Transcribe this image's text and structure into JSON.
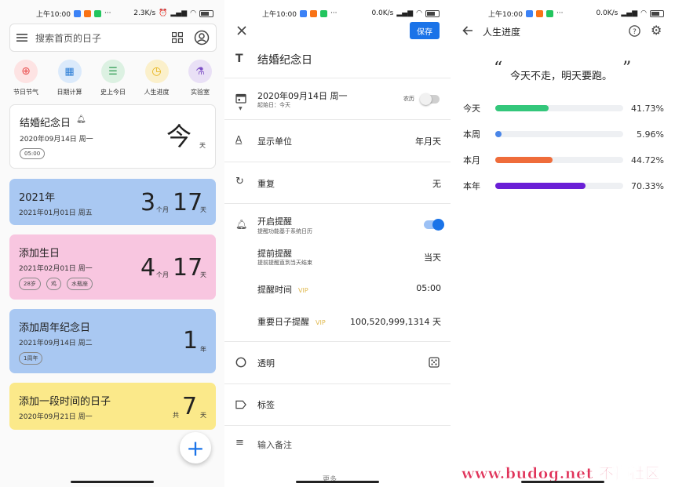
{
  "status_bar": {
    "p1": {
      "time": "上午10:00",
      "dots": "···",
      "speed": "2.3K/s"
    },
    "p2": {
      "time": "上午10:00",
      "dots": "···",
      "speed": "0.0K/s"
    },
    "p3": {
      "time": "上午10:00",
      "dots": "···",
      "speed": "0.0K/s"
    }
  },
  "home": {
    "search_placeholder": "搜索首页的日子",
    "quick_items": [
      {
        "label": "节日节气",
        "icon": "lantern-icon",
        "color": "#ea4f4f",
        "bg": "#fde3e3"
      },
      {
        "label": "日期计算",
        "icon": "calculator-icon",
        "color": "#2f7fd6",
        "bg": "#dbeafb"
      },
      {
        "label": "史上今日",
        "icon": "document-icon",
        "color": "#2e9c52",
        "bg": "#dcf1e2"
      },
      {
        "label": "人生进度",
        "icon": "clock-icon",
        "color": "#e6b010",
        "bg": "#fbf0cb"
      },
      {
        "label": "实验室",
        "icon": "flask-icon",
        "color": "#7d4fc6",
        "bg": "#e9e0f6"
      }
    ],
    "cards": [
      {
        "title": "结婚纪念日",
        "date": "2020年09月14日 周一",
        "tags": [
          "05:00"
        ],
        "number": "今",
        "unit": "天",
        "bg": "#ffffff"
      },
      {
        "title": "2021年",
        "date": "2021年01月01日 周五",
        "tags": [],
        "number1": "3",
        "unit1": "个月",
        "number2": "17",
        "unit2": "天",
        "bg": "#a9c8f2"
      },
      {
        "title": "添加生日",
        "date": "2021年02月01日 周一",
        "tags": [
          "28岁",
          "鸡",
          "水瓶座"
        ],
        "number1": "4",
        "unit1": "个月",
        "number2": "17",
        "unit2": "天",
        "bg": "#f8c6e0"
      },
      {
        "title": "添加周年纪念日",
        "date": "2021年09月14日 周二",
        "tags": [
          "1周年"
        ],
        "number": "1",
        "unit": "年",
        "bg": "#a9c8f2"
      },
      {
        "title": "添加一段时间的日子",
        "date": "2020年09月21日 周一",
        "tags": [],
        "prefix": "共",
        "number": "7",
        "unit": "天",
        "bg": "#fbe98a"
      }
    ],
    "fab": "+"
  },
  "editor": {
    "save_label": "保存",
    "title": "结婚纪念日",
    "date_value": "2020年09月14日 周一",
    "date_sub": "起始日：今天",
    "lunar_label": "农历",
    "display_unit_label": "显示单位",
    "display_unit_value": "年月天",
    "repeat_label": "重复",
    "repeat_value": "无",
    "reminder_label": "开启提醒",
    "reminder_sub": "提醒功能基于系统日历",
    "advance_label": "提前提醒",
    "advance_sub": "提前提醒直到当天结束",
    "advance_value": "当天",
    "remind_time_label": "提醒时间",
    "vip": "VIP",
    "remind_time_value": "05:00",
    "important_label": "重要日子提醒",
    "important_value": "100,520,999,1314 天",
    "transparent_label": "透明",
    "tag_label": "标签",
    "note_placeholder": "输入备注",
    "more_label": "更多"
  },
  "progress": {
    "title": "人生进度",
    "quote": "今天不走，明天要跑。",
    "rows": [
      {
        "label": "今天",
        "percent": 41.73,
        "text": "41.73%",
        "color": "#34c77b"
      },
      {
        "label": "本周",
        "percent": 5.96,
        "text": "5.96%",
        "color": "#4a86e8"
      },
      {
        "label": "本月",
        "percent": 44.72,
        "text": "44.72%",
        "color": "#ef6c3a"
      },
      {
        "label": "本年",
        "percent": 70.33,
        "text": "70.33%",
        "color": "#6a1fd6"
      }
    ],
    "watermark": "www.budog.net 不懂社区"
  }
}
